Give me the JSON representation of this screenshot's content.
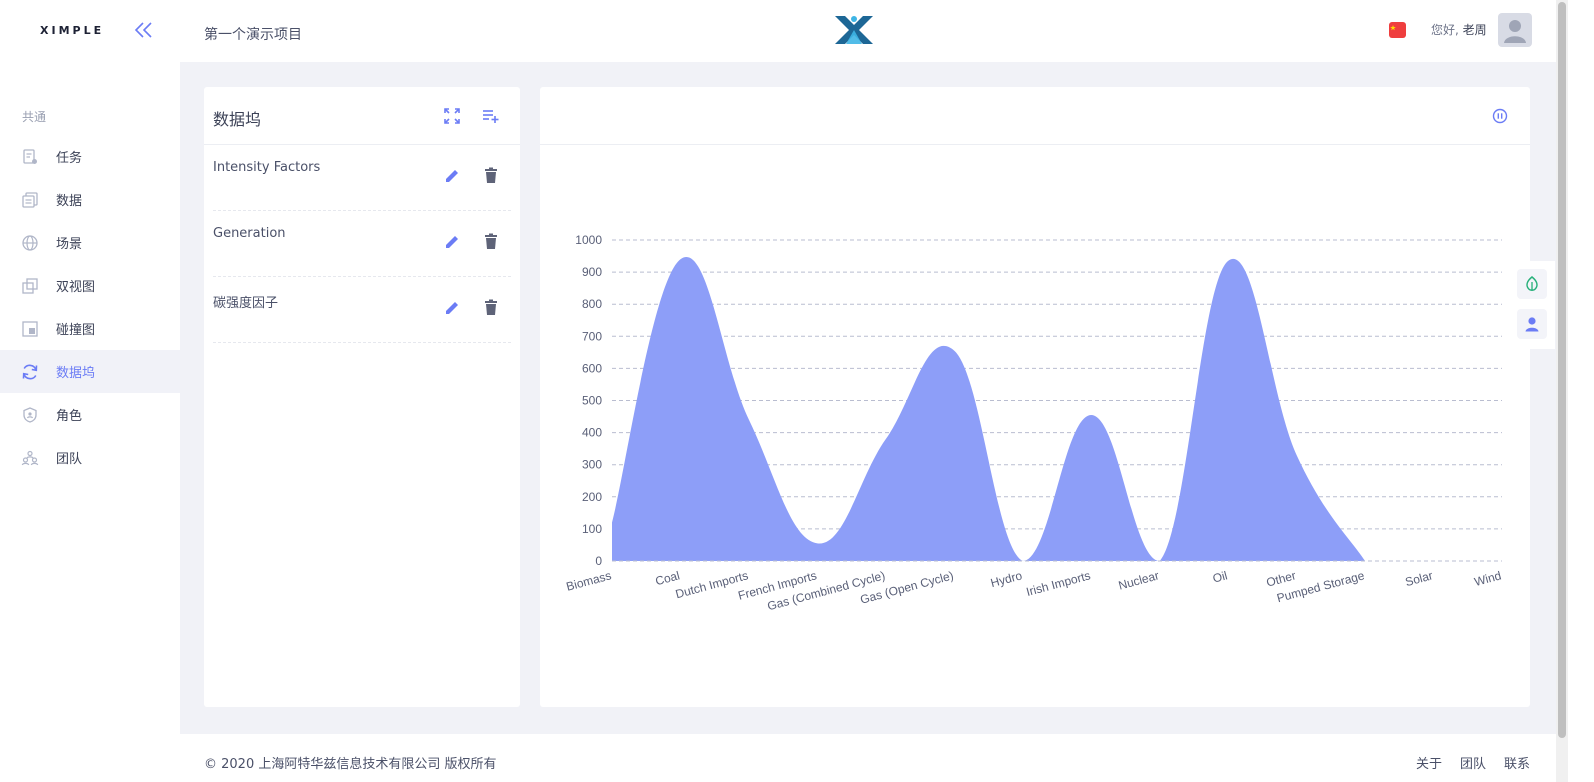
{
  "sidebar": {
    "brand": "XIMPLE",
    "section_label": "共通",
    "items": [
      {
        "label": "任务",
        "icon": "task-icon"
      },
      {
        "label": "数据",
        "icon": "data-icon"
      },
      {
        "label": "场景",
        "icon": "globe-icon"
      },
      {
        "label": "双视图",
        "icon": "dual-view-icon"
      },
      {
        "label": "碰撞图",
        "icon": "collision-icon"
      },
      {
        "label": "数据坞",
        "icon": "sync-icon",
        "active": true
      },
      {
        "label": "角色",
        "icon": "shield-icon"
      },
      {
        "label": "团队",
        "icon": "team-icon"
      }
    ]
  },
  "header": {
    "project_title": "第一个演示项目",
    "greeting": "您好,",
    "user_name": "老周"
  },
  "datasets": {
    "title": "数据坞",
    "items": [
      {
        "name": "Intensity Factors"
      },
      {
        "name": "Generation"
      },
      {
        "name": "碳强度因子"
      }
    ]
  },
  "chart_data": {
    "type": "area",
    "categories": [
      "Biomass",
      "Coal",
      "Dutch Imports",
      "French Imports",
      "Gas (Combined Cycle)",
      "Gas (Open Cycle)",
      "Hydro",
      "Irish Imports",
      "Nuclear",
      "Oil",
      "Other",
      "Pumped Storage",
      "Solar",
      "Wind"
    ],
    "values": [
      120,
      940,
      440,
      55,
      380,
      655,
      0,
      455,
      0,
      935,
      330,
      0,
      null,
      null
    ],
    "ylim": [
      0,
      1000
    ],
    "yticks": [
      0,
      100,
      200,
      300,
      400,
      500,
      600,
      700,
      800,
      900,
      1000
    ],
    "grid": true,
    "color": "#8d9ef8"
  },
  "footer": {
    "copyright": "© 2020 上海阿特华兹信息技术有限公司 版权所有",
    "links": [
      "关于",
      "团队",
      "联系"
    ]
  },
  "colors": {
    "accent": "#6b7cf5",
    "delete": "#5e6378",
    "flag": "#ef3e3e",
    "float_green": "#27b07a"
  }
}
